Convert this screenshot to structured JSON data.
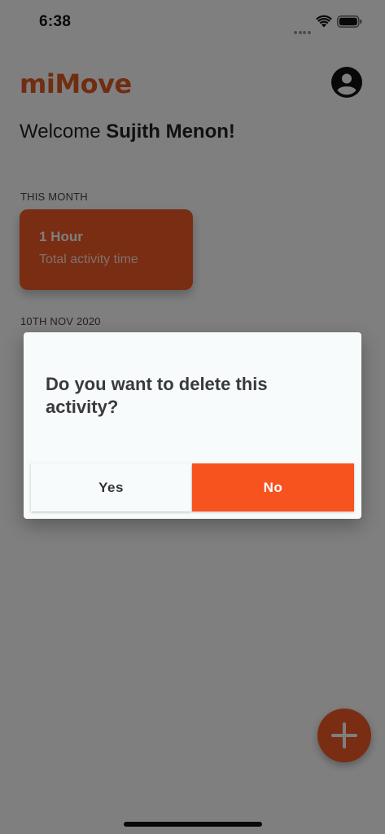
{
  "status_bar": {
    "time": "6:38"
  },
  "app": {
    "logo_text": "miMove",
    "accent_color": "#f25a24"
  },
  "welcome": {
    "prefix": "Welcome ",
    "user_name": "Sujith Menon!"
  },
  "this_month": {
    "label": "THIS MONTH",
    "card": {
      "value": "1 Hour",
      "caption": "Total activity time"
    }
  },
  "activity_group": {
    "date_label": "10TH NOV 2020"
  },
  "dialog": {
    "message": "Do you want to delete this activity?",
    "yes_label": "Yes",
    "no_label": "No"
  },
  "icons": {
    "profile": "account-circle-icon",
    "add": "plus-icon",
    "wifi": "wifi-icon",
    "battery": "battery-icon",
    "signal": "signal-icon"
  }
}
